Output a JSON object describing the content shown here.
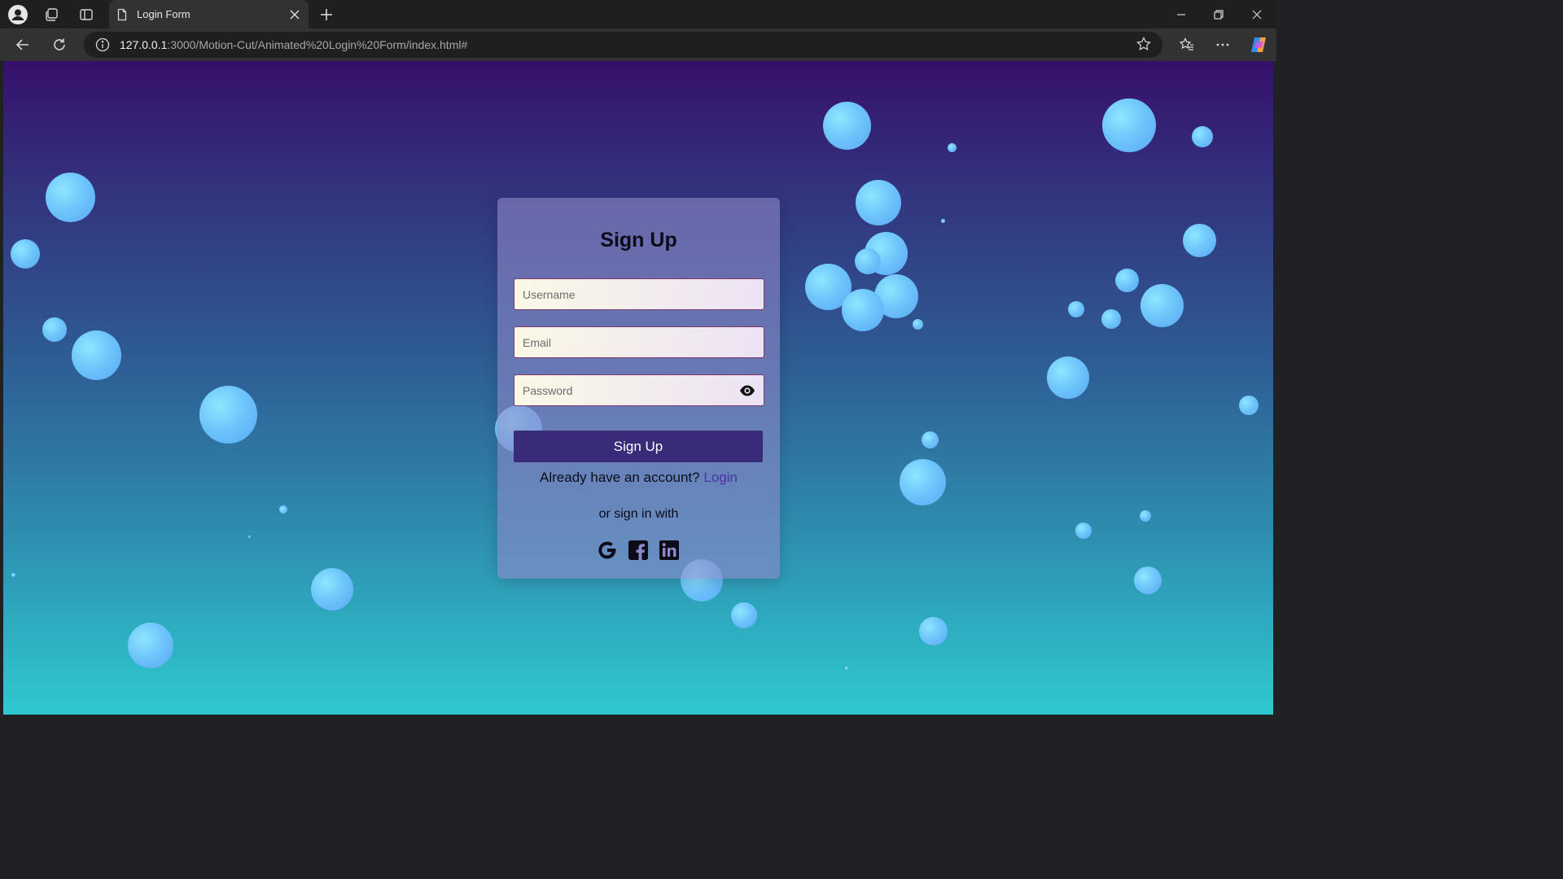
{
  "browser": {
    "tab_title": "Login Form",
    "url_host": "127.0.0.1",
    "url_path": ":3000/Motion-Cut/Animated%20Login%20Form/index.html#"
  },
  "form": {
    "title": "Sign Up",
    "username_placeholder": "Username",
    "email_placeholder": "Email",
    "password_placeholder": "Password",
    "submit_label": "Sign Up",
    "have_account_text": "Already have an account?",
    "login_link": "Login",
    "or_sign_in_text": "or sign in with",
    "social_icons": [
      "google-icon",
      "facebook-icon",
      "linkedin-icon"
    ]
  },
  "colors": {
    "gradient_top": "#36106b",
    "gradient_bottom": "#2fc9cf",
    "button": "#3a2a7a",
    "link": "#4a32a2"
  }
}
